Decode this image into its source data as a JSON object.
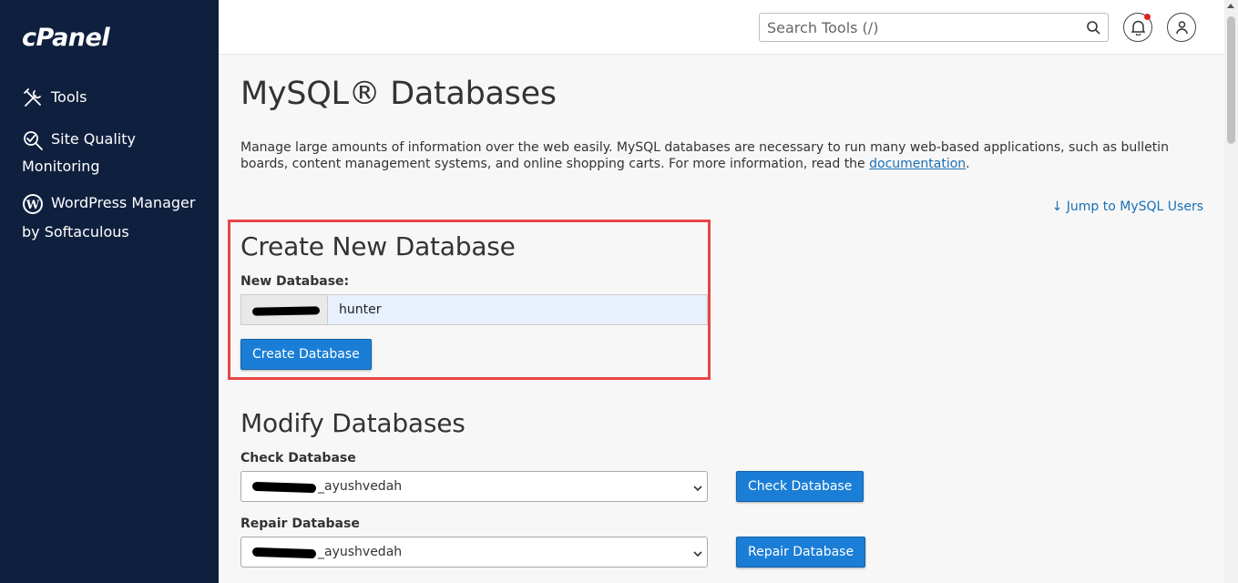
{
  "sidebar": {
    "logo": "cPanel",
    "items": [
      {
        "label": "Tools",
        "icon": "tools-icon"
      },
      {
        "label": "Site Quality",
        "label2": "Monitoring",
        "icon": "site-quality-icon"
      },
      {
        "label": "WordPress Manager",
        "label2": "by Softaculous",
        "icon": "wordpress-icon"
      }
    ]
  },
  "header": {
    "search_placeholder": "Search Tools (/)",
    "notification_dot_color": "#e0211e"
  },
  "main": {
    "title": "MySQL® Databases",
    "description": "Manage large amounts of information over the web easily. MySQL databases are necessary to run many web-based applications, such as bulletin boards, content management systems, and online shopping carts. For more information, read the ",
    "doc_link": "documentation",
    "description_end": ".",
    "jump_link": "↓ Jump to MySQL Users",
    "create": {
      "title": "Create New Database",
      "label": "New Database:",
      "prefix": "",
      "value": "hunter",
      "button": "Create Database",
      "highlight_color": "#e84545"
    },
    "modify": {
      "title": "Modify Databases",
      "check_label": "Check Database",
      "check_value": "_ayushvedah",
      "check_button": "Check Database",
      "repair_label": "Repair Database",
      "repair_value": "_ayushvedah",
      "repair_button": "Repair Database"
    }
  }
}
